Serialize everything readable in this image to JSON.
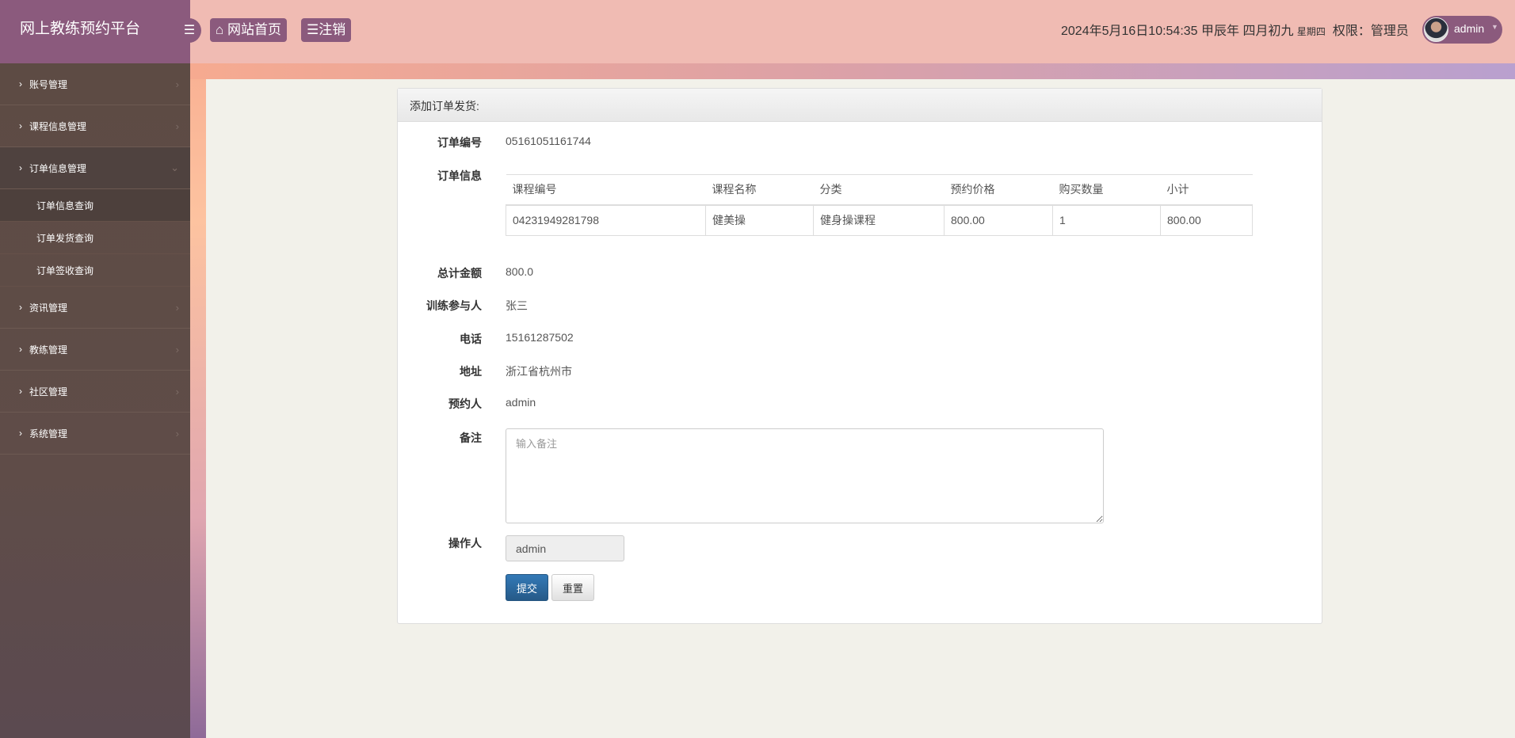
{
  "app": {
    "title": "网上教练预约平台"
  },
  "header": {
    "home_label": "网站首页",
    "logout_label": "注销",
    "datetime": "2024年5月16日10:54:35 甲辰年 四月初九",
    "weekday": "星期四",
    "role": "权限：管理员",
    "user": "admin"
  },
  "sidebar": {
    "items": [
      {
        "label": "账号管理"
      },
      {
        "label": "课程信息管理"
      },
      {
        "label": "订单信息管理",
        "sub": [
          {
            "label": "订单信息查询"
          },
          {
            "label": "订单发货查询"
          },
          {
            "label": "订单签收查询"
          }
        ]
      },
      {
        "label": "资讯管理"
      },
      {
        "label": "教练管理"
      },
      {
        "label": "社区管理"
      },
      {
        "label": "系统管理"
      }
    ]
  },
  "panel": {
    "title": "添加订单发货:"
  },
  "form": {
    "order_no_label": "订单编号",
    "order_no": "05161051161744",
    "order_info_label": "订单信息",
    "table": {
      "headers": [
        "课程编号",
        "课程名称",
        "分类",
        "预约价格",
        "购买数量",
        "小计"
      ],
      "rows": [
        [
          "04231949281798",
          "健美操",
          "健身操课程",
          "800.00",
          "1",
          "800.00"
        ]
      ]
    },
    "total_label": "总计金额",
    "total": "800.0",
    "participant_label": "训练参与人",
    "participant": "张三",
    "phone_label": "电话",
    "phone": "15161287502",
    "address_label": "地址",
    "address": "浙江省杭州市",
    "booker_label": "预约人",
    "booker": "admin",
    "remark_label": "备注",
    "remark_placeholder": "输入备注",
    "operator_label": "操作人",
    "operator": "admin",
    "submit_label": "提交",
    "reset_label": "重置"
  }
}
